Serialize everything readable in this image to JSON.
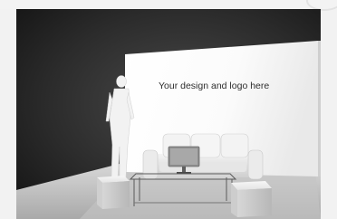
{
  "banner": {
    "text": "Your design and logo here"
  }
}
